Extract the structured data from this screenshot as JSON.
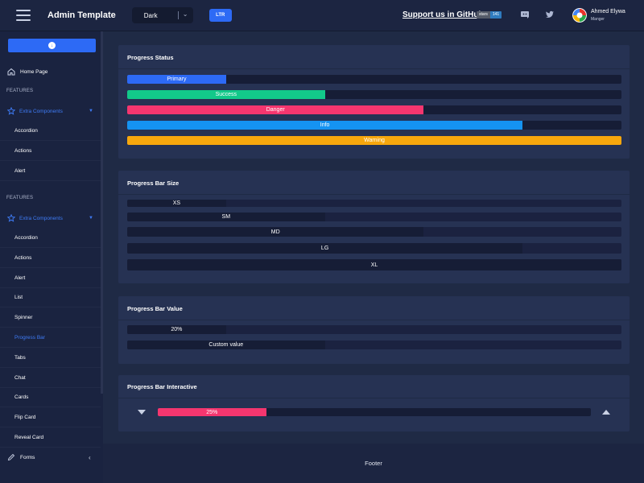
{
  "header": {
    "title": "Admin Template",
    "theme_value": "Dark",
    "direction_label": "LTR",
    "support_text": "Support us in GitHub",
    "stars_label": "stars",
    "stars_count": "141",
    "user_name": "Ahmed Elywa",
    "user_role": "Manger"
  },
  "sidebar": {
    "home": "Home Page",
    "section1": "FEATURES",
    "group1": "Extra Components",
    "group1_items": [
      "Accordion",
      "Actions",
      "Alert"
    ],
    "section2": "FEATURES",
    "group2": "Extra Components",
    "group2_items": [
      "Accordion",
      "Actions",
      "Alert",
      "List",
      "Spinner",
      "Progress Bar",
      "Tabs",
      "Chat",
      "Cards",
      "Flip Card",
      "Reveal Card"
    ],
    "forms": "Forms",
    "accent": "#3f7cf7"
  },
  "status": {
    "title": "Progress Status",
    "bars": [
      {
        "label": "Primary",
        "value": 20,
        "color": "#2d6af5"
      },
      {
        "label": "Success",
        "value": 40,
        "color": "#12c98a"
      },
      {
        "label": "Danger",
        "value": 60,
        "color": "#f5366f"
      },
      {
        "label": "Info",
        "value": 80,
        "color": "#1593f2"
      },
      {
        "label": "Warning",
        "value": 100,
        "color": "#f7a70d"
      }
    ]
  },
  "size": {
    "title": "Progress Bar Size",
    "bars": [
      {
        "label": "XS",
        "value": 20
      },
      {
        "label": "SM",
        "value": 40
      },
      {
        "label": "MD",
        "value": 60
      },
      {
        "label": "LG",
        "value": 80
      },
      {
        "label": "XL",
        "value": 100
      }
    ]
  },
  "value": {
    "title": "Progress Bar Value",
    "bars": [
      {
        "label": "20%",
        "value": 20
      },
      {
        "label": "Custom value",
        "value": 40
      }
    ]
  },
  "interactive": {
    "title": "Progress Bar Interactive",
    "label": "25%",
    "value": 25,
    "color": "#f5366f"
  },
  "footer": "Footer"
}
